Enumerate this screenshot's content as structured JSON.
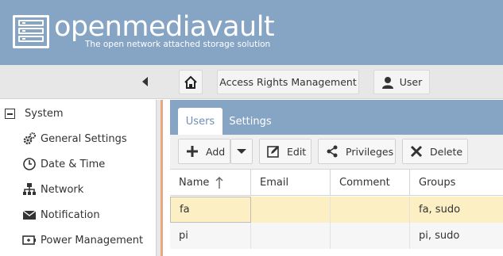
{
  "header": {
    "brand": "openmediavault",
    "tagline": "The open network attached storage solution"
  },
  "breadcrumb": {
    "home_icon": "home-icon",
    "section": "Access Rights Management",
    "page": "User",
    "page_icon": "user-icon"
  },
  "nav": {
    "group": "System",
    "items": [
      {
        "label": "General Settings",
        "icon": "gears-icon"
      },
      {
        "label": "Date & Time",
        "icon": "clock-icon"
      },
      {
        "label": "Network",
        "icon": "network-icon"
      },
      {
        "label": "Notification",
        "icon": "envelope-icon"
      },
      {
        "label": "Power Management",
        "icon": "power-icon"
      }
    ]
  },
  "tabs": [
    {
      "label": "Users",
      "active": true
    },
    {
      "label": "Settings",
      "active": false
    }
  ],
  "toolbar": {
    "add": "Add",
    "edit": "Edit",
    "privileges": "Privileges",
    "delete": "Delete"
  },
  "table": {
    "columns": [
      "Name",
      "Email",
      "Comment",
      "Groups"
    ],
    "sort_column": "Name",
    "sort_direction": "ascending",
    "rows": [
      {
        "name": "fa",
        "email": "",
        "comment": "",
        "groups": "fa, sudo",
        "selected": true
      },
      {
        "name": "pi",
        "email": "",
        "comment": "",
        "groups": "pi, sudo",
        "selected": false
      }
    ]
  },
  "colors": {
    "header_bg": "#86a5c5",
    "selected_row": "#fcefc4",
    "nav_accent": "#e8a77c"
  }
}
